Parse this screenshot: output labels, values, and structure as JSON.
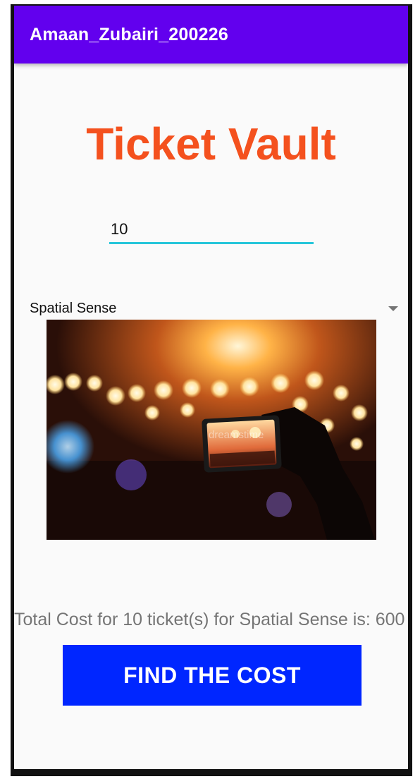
{
  "app_bar": {
    "title": "Amaan_Zubairi_200226",
    "color": "#6200ee"
  },
  "heading": {
    "text": "Ticket Vault",
    "color": "#f4511e"
  },
  "ticket_input": {
    "value": "10",
    "underline_color": "#26c6da"
  },
  "event_spinner": {
    "selected": "Spatial Sense",
    "icon": "dropdown-arrow-icon"
  },
  "event_image": {
    "watermark": "dreamstime"
  },
  "result": {
    "text": "Total Cost for 10 ticket(s) for Spatial Sense is: 600"
  },
  "find_button": {
    "label": "FIND THE COST",
    "color": "#0026ff"
  }
}
